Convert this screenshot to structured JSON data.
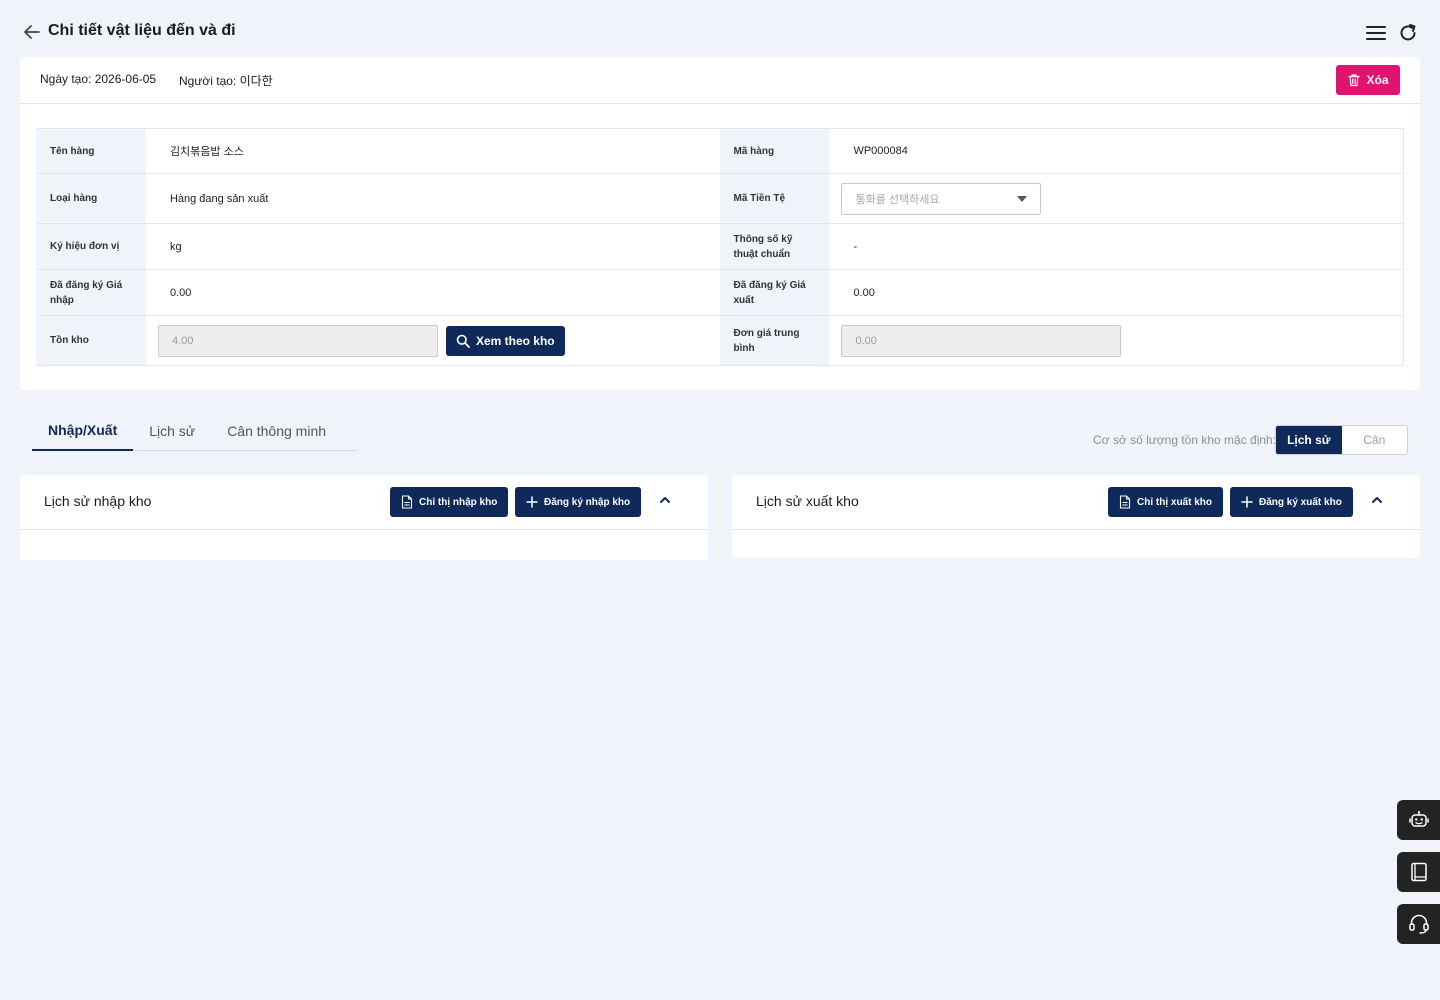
{
  "header": {
    "title": "Chi tiết vật liệu đến và đi"
  },
  "info": {
    "created": "Ngày tạo: 2026-06-05",
    "creator": "Người tạo: 이다한",
    "delete_label": "Xóa"
  },
  "fields": {
    "item_name_label": "Tên hàng",
    "item_name": "김치볶음밥 소스",
    "item_code_label": "Mã hàng",
    "item_code": "WP000084",
    "item_type_label": "Loại hàng",
    "item_type": "Hàng đang sản xuất",
    "currency_label": "Mã Tiền Tệ",
    "currency_placeholder": "통화를 선택하세요",
    "unit_label": "Ký hiệu đơn vị",
    "unit": "kg",
    "spec_label": "Thông số kỹ thuật chuẩn",
    "spec": "-",
    "buy_price_label": "Đã đăng ký Giá nhập",
    "buy_price": "0.00",
    "sell_price_label": "Đã đăng ký Giá xuất",
    "sell_price": "0.00",
    "stock_label": "Tồn kho",
    "stock": "4.00",
    "view_by_warehouse": "Xem theo kho",
    "avg_price_label": "Đơn giá trung bình",
    "avg_price": "0.00"
  },
  "tabs": [
    {
      "label": "Nhập/Xuất",
      "active": true
    },
    {
      "label": "Lịch sử",
      "active": false
    },
    {
      "label": "Cân thông minh",
      "active": false
    }
  ],
  "basis": {
    "label": "Cơ sở số lượng tồn kho mặc định:",
    "options": [
      "Lịch sử",
      "Cân"
    ],
    "selected": "Lịch sử"
  },
  "inbound": {
    "title": "Lịch sử nhập kho",
    "instruction_btn": "Chỉ thị nhập kho",
    "register_btn": "Đăng ký nhập kho"
  },
  "outbound": {
    "title": "Lịch sử xuất kho",
    "instruction_btn": "Chỉ thị xuất kho",
    "register_btn": "Đăng ký xuất kho"
  },
  "colors": {
    "primary": "#0f2a5a",
    "danger": "#e0146f",
    "background": "#f0f3f9"
  },
  "icons": [
    "arrow-left-icon",
    "hamburger-menu-icon",
    "refresh-icon",
    "trash-icon",
    "search-icon",
    "caret-down-icon",
    "document-icon",
    "plus-icon",
    "chevron-up-icon",
    "robot-icon",
    "book-icon",
    "headset-icon"
  ]
}
